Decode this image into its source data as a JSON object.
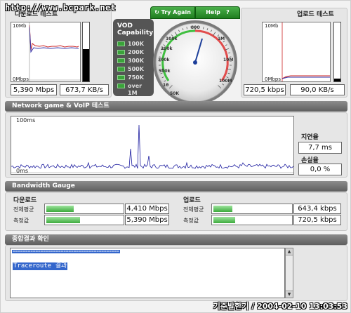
{
  "watermark_url": "http://www.bcpark.net",
  "download": {
    "title": "다운로드 테스트",
    "axis_top": "10Mb",
    "axis_bottom": "0Mbps",
    "mbps": "5,390 Mbps",
    "kbs": "673,7 KB/s",
    "level": 0.55
  },
  "upload": {
    "title": "업로드 테스트",
    "axis_top": "10Mb",
    "axis_bottom": "0Mbps",
    "kbps": "720,5 kbps",
    "kbs": "90,0 KB/s",
    "level": 0.05
  },
  "vod": {
    "title_line1": "VOD",
    "title_line2": "Capability",
    "items": [
      "100K",
      "200K",
      "300K",
      "500K",
      "750K",
      "over 1M"
    ]
  },
  "gauge": {
    "try_again_label": "Try Again",
    "help_label": "Help",
    "help_icon": "?",
    "tick_labels": [
      "100k",
      "200k",
      "300k",
      "500k",
      "800",
      "1M",
      "10M",
      "100M",
      "10",
      "50K"
    ],
    "needle_icon": "needle-icon"
  },
  "network": {
    "title": "Network game & VoIP 테스트",
    "axis_top": "100ms",
    "axis_bottom": "0ms",
    "latency_label": "지연율",
    "latency_value": "7,7 ms",
    "loss_label": "손실율",
    "loss_value": "0,0 %"
  },
  "bandwidth": {
    "title": "Bandwidth Gauge",
    "download_title": "다운로드",
    "upload_title": "업로드",
    "avg_label": "전체평균",
    "measured_label": "측정값",
    "download_avg": "4,410 Mbps",
    "download_measured": "5,390 Mbps",
    "upload_avg": "643,4 kbps",
    "upload_measured": "720,5 kbps",
    "download_avg_fill": 0.35,
    "download_measured_fill": 0.43,
    "upload_avg_fill": 0.24,
    "upload_measured_fill": 0.27
  },
  "results": {
    "title": "종합결과 확인",
    "dashes": "==========================================",
    "traceroute_label": "Traceroute 결과"
  },
  "footer": {
    "timestamp": "기준발한기 / 2004-02-10 13:03:53"
  }
}
